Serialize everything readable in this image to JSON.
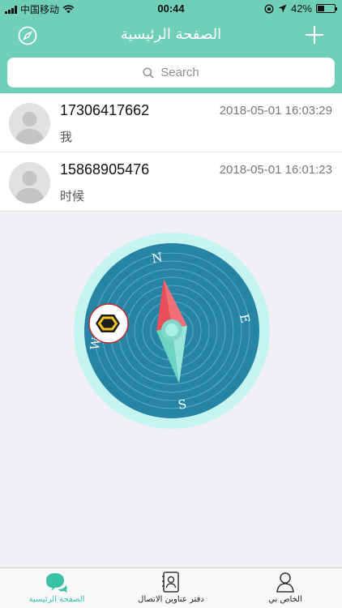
{
  "status_bar": {
    "carrier": "中国移动",
    "time": "00:44",
    "battery": "42%",
    "battery_level": 0.42
  },
  "navbar": {
    "title": "الصفحة الرئيسية",
    "left_icon": "compass-icon",
    "right_icon": "plus-icon"
  },
  "search": {
    "placeholder": "Search"
  },
  "conversations": [
    {
      "name": "17306417662",
      "message": "我",
      "time": "2018-05-01 16:03:29"
    },
    {
      "name": "15868905476",
      "message": "时候",
      "time": "2018-05-01 16:01:23"
    }
  ],
  "compass": {
    "north": "N",
    "east": "E",
    "south": "S",
    "west": "W"
  },
  "tabbar": {
    "items": [
      {
        "label": "الصفحة الرئيسية",
        "icon": "chat-bubbles-icon",
        "active": true
      },
      {
        "label": "دفتر عناوين الاتصال",
        "icon": "address-book-icon",
        "active": false
      },
      {
        "label": "الخاص بي",
        "icon": "person-icon",
        "active": false
      }
    ]
  },
  "colors": {
    "accent": "#6fcfb7",
    "tab_active": "#3ac2a6",
    "compass_face": "#2784a5",
    "compass_ring": "#bff3ef"
  }
}
